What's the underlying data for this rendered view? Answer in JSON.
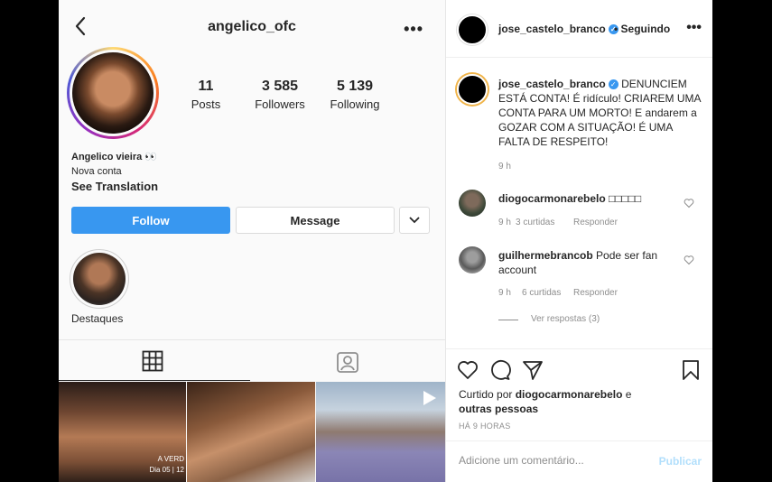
{
  "profile": {
    "username": "angelico_ofc",
    "more_label": "•••",
    "stats": [
      {
        "num": "11",
        "label": "Posts"
      },
      {
        "num": "3 585",
        "label": "Followers"
      },
      {
        "num": "5 139",
        "label": "Following"
      }
    ],
    "bio_name": "Angelico vieira 👀",
    "bio_line": "Nova conta",
    "see_translation": "See Translation",
    "follow_label": "Follow",
    "message_label": "Message",
    "highlight_label": "Destaques",
    "thumb1_caption": "A VERD\nDia 05 | 12"
  },
  "post": {
    "author": "jose_castelo_branco",
    "verified_mark": "✓",
    "following_label": "• Seguindo",
    "more_label": "•••",
    "caption": "DENUNCIEM ESTÁ CONTA! É ridículo! CRIAREM UMA CONTA PARA UM MORTO! E andarem a GOZAR COM A SITUAÇÃO! É UMA FALTA DE RESPEITO!",
    "caption_time": "9 h",
    "comments": [
      {
        "user": "diogocarmonarebelo",
        "text": "□□□□□",
        "time": "9 h",
        "likes": "3 curtidas",
        "reply": "Responder"
      },
      {
        "user": "guilhermebrancob",
        "text": "Pode ser fan account",
        "time": "9 h",
        "likes": "6 curtidas",
        "reply": "Responder"
      }
    ],
    "view_replies": "Ver respostas (3)",
    "liked_prefix": "Curtido por",
    "liked_user": "diogocarmonarebelo",
    "liked_suffix": "e",
    "liked_others": "outras pessoas",
    "time_ago": "HÁ 9 HORAS",
    "comment_placeholder": "Adicione um comentário...",
    "publish_label": "Publicar"
  },
  "colors": {
    "accent": "#3897f0",
    "publish_disabled": "#b2dffc"
  }
}
